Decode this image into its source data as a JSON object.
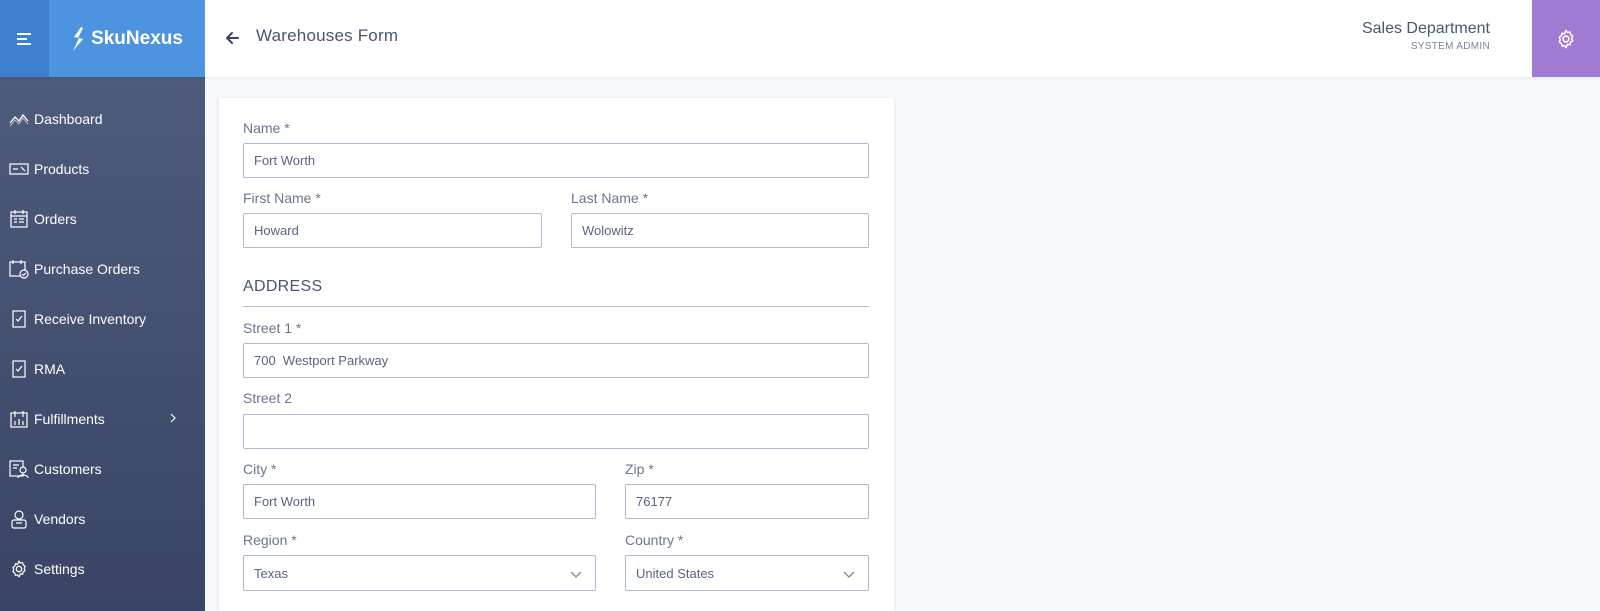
{
  "header": {
    "logo_text": "SkuNexus",
    "page_title": "Warehouses Form",
    "user_name": "Sales Department",
    "user_role": "SYSTEM ADMIN"
  },
  "colors": {
    "hamburger_bg": "#3f7fcf",
    "logo_bg": "#4d94e0",
    "settings_bg": "#a17bd1",
    "sidebar_top": "#4d5b7c",
    "sidebar_bottom": "#3a4565"
  },
  "sidebar": {
    "items": [
      {
        "label": "Dashboard",
        "icon": "chart-icon"
      },
      {
        "label": "Products",
        "icon": "tag-icon"
      },
      {
        "label": "Orders",
        "icon": "calendar-icon"
      },
      {
        "label": "Purchase Orders",
        "icon": "purchase-icon"
      },
      {
        "label": "Receive Inventory",
        "icon": "clipboard-icon"
      },
      {
        "label": "RMA",
        "icon": "clipboard-icon"
      },
      {
        "label": "Fulfillments",
        "icon": "fulfillment-icon"
      },
      {
        "label": "Customers",
        "icon": "customers-icon"
      },
      {
        "label": "Vendors",
        "icon": "vendor-icon"
      },
      {
        "label": "Settings",
        "icon": "gear-icon"
      }
    ]
  },
  "form": {
    "name": {
      "label": "Name *",
      "value": "Fort Worth"
    },
    "first_name": {
      "label": "First Name *",
      "value": "Howard"
    },
    "last_name": {
      "label": "Last Name *",
      "value": "Wolowitz"
    },
    "address_title": "ADDRESS",
    "street1": {
      "label": "Street 1 *",
      "value": "700  Westport Parkway"
    },
    "street2": {
      "label": "Street 2",
      "value": ""
    },
    "city": {
      "label": "City *",
      "value": "Fort Worth"
    },
    "zip": {
      "label": "Zip *",
      "value": "76177"
    },
    "region": {
      "label": "Region *",
      "value": "Texas"
    },
    "country": {
      "label": "Country *",
      "value": "United States"
    }
  }
}
